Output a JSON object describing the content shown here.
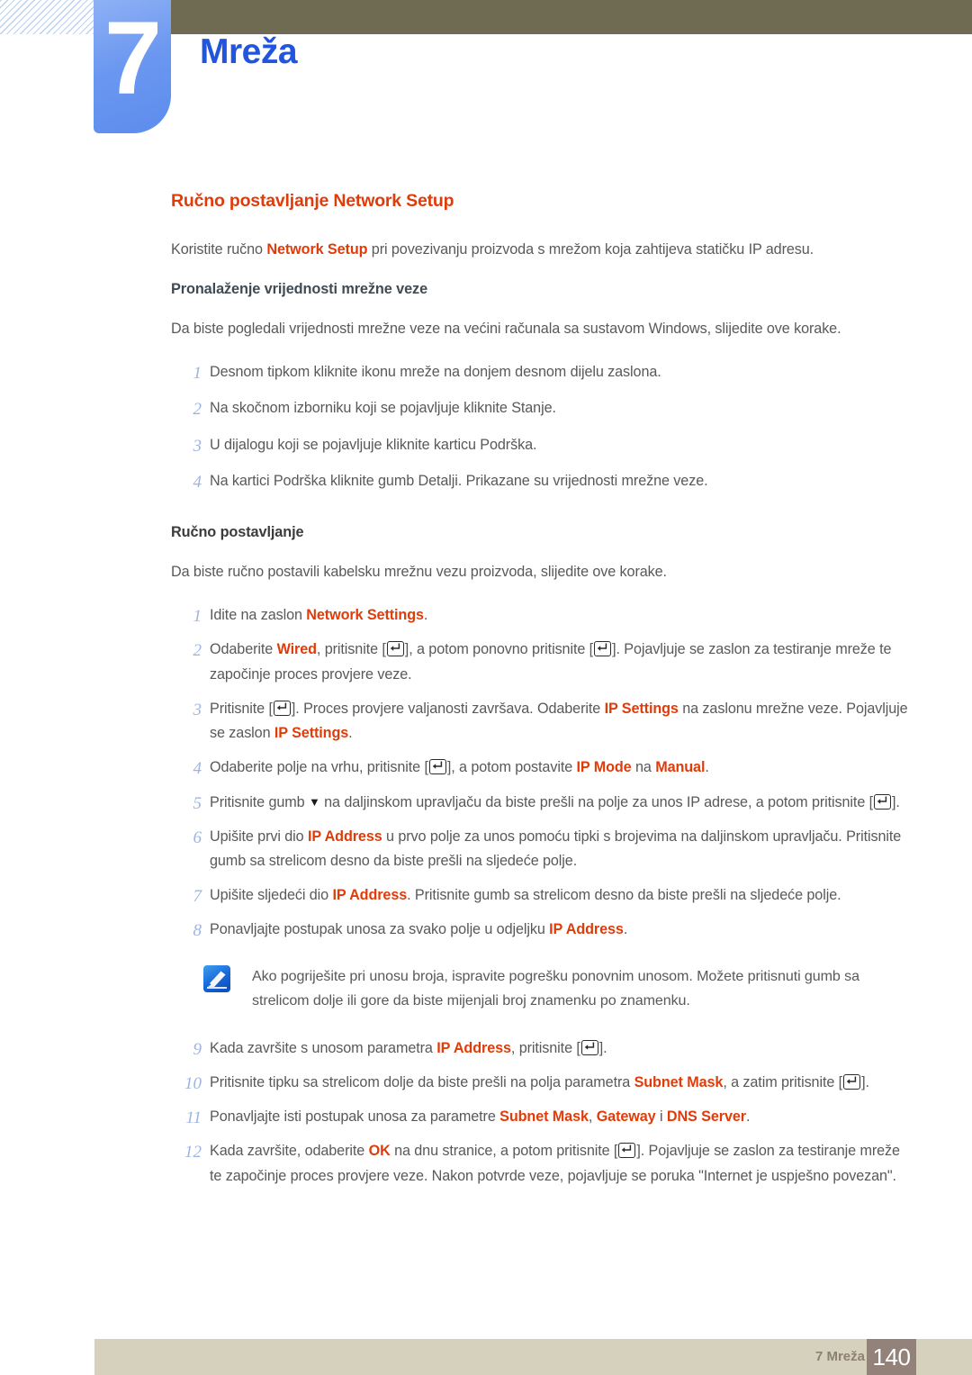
{
  "header": {
    "chapter_number": "7",
    "chapter_title": "Mreža",
    "accent_blue": "#2255dd",
    "tab_blue": "#6b97f0",
    "olive": "#6e6b52"
  },
  "colors": {
    "highlight_orange": "#e03c0a",
    "body_text": "#58595b",
    "step_number": "#9eb4e6",
    "subheading_teal": "#3f4b54"
  },
  "main": {
    "section_heading": "Ručno postavljanje Network Setup",
    "intro": {
      "before": "Koristite ručno ",
      "highlight": "Network Setup",
      "after": " pri povezivanju proizvoda s mrežom koja zahtijeva statičku IP adresu."
    },
    "subheading_1": "Pronalaženje vrijednosti mrežne veze",
    "para_1": "Da biste pogledali vrijednosti mrežne veze na većini računala sa sustavom Windows, slijedite ove korake.",
    "list_1": [
      {
        "num": "1",
        "text": "Desnom tipkom kliknite ikonu mreže na donjem desnom dijelu zaslona."
      },
      {
        "num": "2",
        "text": "Na skočnom izborniku koji se pojavljuje kliknite Stanje."
      },
      {
        "num": "3",
        "text": "U dijalogu koji se pojavljuje kliknite karticu Podrška."
      },
      {
        "num": "4",
        "text": "Na kartici Podrška kliknite gumb Detalji. Prikazane su vrijednosti mrežne veze."
      }
    ],
    "subheading_2": "Ručno postavljanje",
    "para_2": "Da biste ručno postavili kabelsku mrežnu vezu proizvoda, slijedite ove korake.",
    "list_2": [
      {
        "num": "1",
        "parts": [
          {
            "t": "text",
            "v": "Idite na zaslon "
          },
          {
            "t": "hl",
            "v": "Network Settings"
          },
          {
            "t": "text",
            "v": "."
          }
        ]
      },
      {
        "num": "2",
        "parts": [
          {
            "t": "text",
            "v": "Odaberite "
          },
          {
            "t": "hl",
            "v": "Wired"
          },
          {
            "t": "text",
            "v": ", pritisnite ["
          },
          {
            "t": "key",
            "v": "enter-key-icon"
          },
          {
            "t": "text",
            "v": "], a potom ponovno pritisnite ["
          },
          {
            "t": "key",
            "v": "enter-key-icon"
          },
          {
            "t": "text",
            "v": "]. Pojavljuje se zaslon za testiranje mreže te započinje proces provjere veze."
          }
        ]
      },
      {
        "num": "3",
        "parts": [
          {
            "t": "text",
            "v": "Pritisnite ["
          },
          {
            "t": "key",
            "v": "enter-key-icon"
          },
          {
            "t": "text",
            "v": "]. Proces provjere valjanosti završava. Odaberite "
          },
          {
            "t": "hl",
            "v": "IP Settings"
          },
          {
            "t": "text",
            "v": " na zaslonu mrežne veze. Pojavljuje se zaslon "
          },
          {
            "t": "hl",
            "v": "IP Settings"
          },
          {
            "t": "text",
            "v": "."
          }
        ]
      },
      {
        "num": "4",
        "parts": [
          {
            "t": "text",
            "v": "Odaberite polje na vrhu, pritisnite ["
          },
          {
            "t": "key",
            "v": "enter-key-icon"
          },
          {
            "t": "text",
            "v": "], a potom postavite "
          },
          {
            "t": "hl",
            "v": "IP Mode"
          },
          {
            "t": "text",
            "v": " na "
          },
          {
            "t": "hl",
            "v": "Manual"
          },
          {
            "t": "text",
            "v": "."
          }
        ]
      },
      {
        "num": "5",
        "parts": [
          {
            "t": "text",
            "v": "Pritisnite gumb "
          },
          {
            "t": "tri",
            "v": "triangle-down-icon"
          },
          {
            "t": "text",
            "v": " na daljinskom upravljaču da biste prešli na polje za unos IP adrese, a potom pritisnite ["
          },
          {
            "t": "key",
            "v": "enter-key-icon"
          },
          {
            "t": "text",
            "v": "]."
          }
        ]
      },
      {
        "num": "6",
        "parts": [
          {
            "t": "text",
            "v": "Upišite prvi dio "
          },
          {
            "t": "hl",
            "v": "IP Address"
          },
          {
            "t": "text",
            "v": " u prvo polje za unos pomoću tipki s brojevima na daljinskom upravljaču. Pritisnite gumb sa strelicom desno da biste prešli na sljedeće polje."
          }
        ]
      },
      {
        "num": "7",
        "parts": [
          {
            "t": "text",
            "v": "Upišite sljedeći dio "
          },
          {
            "t": "hl",
            "v": "IP Address"
          },
          {
            "t": "text",
            "v": ". Pritisnite gumb sa strelicom desno da biste prešli na sljedeće polje."
          }
        ]
      },
      {
        "num": "8",
        "parts": [
          {
            "t": "text",
            "v": "Ponavljajte postupak unosa za svako polje u odjeljku "
          },
          {
            "t": "hl",
            "v": "IP Address"
          },
          {
            "t": "text",
            "v": "."
          }
        ]
      }
    ],
    "note": {
      "icon": "note-pencil-icon",
      "text": "Ako pogriješite pri unosu broja, ispravite pogrešku ponovnim unosom. Možete pritisnuti gumb sa strelicom dolje ili gore da biste mijenjali broj znamenku po znamenku."
    },
    "list_3": [
      {
        "num": "9",
        "parts": [
          {
            "t": "text",
            "v": "Kada završite s unosom parametra "
          },
          {
            "t": "hl",
            "v": "IP Address"
          },
          {
            "t": "text",
            "v": ", pritisnite ["
          },
          {
            "t": "key",
            "v": "enter-key-icon"
          },
          {
            "t": "text",
            "v": "]."
          }
        ]
      },
      {
        "num": "10",
        "parts": [
          {
            "t": "text",
            "v": "Pritisnite tipku sa strelicom dolje da biste prešli na polja parametra "
          },
          {
            "t": "hl",
            "v": "Subnet Mask"
          },
          {
            "t": "text",
            "v": ", a zatim pritisnite ["
          },
          {
            "t": "key",
            "v": "enter-key-icon"
          },
          {
            "t": "text",
            "v": "]."
          }
        ]
      },
      {
        "num": "11",
        "parts": [
          {
            "t": "text",
            "v": "Ponavljajte isti postupak unosa za parametre "
          },
          {
            "t": "hl",
            "v": "Subnet Mask"
          },
          {
            "t": "text",
            "v": ", "
          },
          {
            "t": "hl",
            "v": "Gateway"
          },
          {
            "t": "text",
            "v": " i "
          },
          {
            "t": "hl",
            "v": "DNS Server"
          },
          {
            "t": "text",
            "v": "."
          }
        ]
      },
      {
        "num": "12",
        "parts": [
          {
            "t": "text",
            "v": "Kada završite, odaberite "
          },
          {
            "t": "hl",
            "v": "OK"
          },
          {
            "t": "text",
            "v": " na dnu stranice, a potom pritisnite ["
          },
          {
            "t": "key",
            "v": "enter-key-icon"
          },
          {
            "t": "text",
            "v": "]. Pojavljuje se zaslon za testiranje mreže te započinje proces provjere veze. Nakon potvrde veze, pojavljuje se poruka \"Internet je uspješno povezan\"."
          }
        ]
      }
    ]
  },
  "footer": {
    "label": "7 Mreža",
    "page_number": "140"
  }
}
